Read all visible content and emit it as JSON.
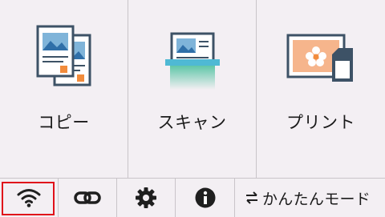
{
  "tiles": [
    {
      "label": "コピー",
      "icon": "copy-icon"
    },
    {
      "label": "スキャン",
      "icon": "scan-icon"
    },
    {
      "label": "プリント",
      "icon": "print-photo-icon"
    }
  ],
  "bottom_bar": {
    "wifi_icon": "wifi-icon",
    "link_icon": "link-icon",
    "settings_icon": "gear-icon",
    "info_icon": "info-icon",
    "easy_mode_label": "かんたんモード",
    "easy_mode_icon": "swap-arrows-icon"
  },
  "colors": {
    "background": "#f3eff3",
    "selection_outline": "#e0101a",
    "icon_dark": "#1f1f1f",
    "accent_teal": "#4fb9d4",
    "accent_orange": "#f28c3c"
  }
}
